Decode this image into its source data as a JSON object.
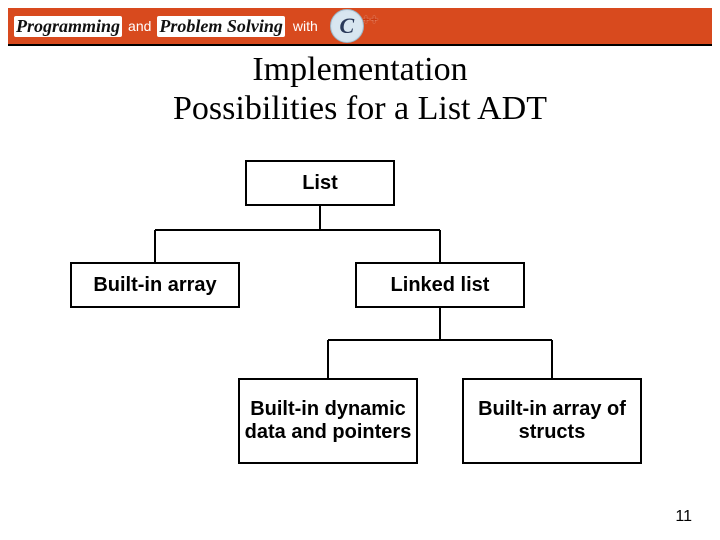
{
  "header": {
    "programming": "Programming",
    "and": "and",
    "problem_solving": "Problem Solving",
    "with": "with",
    "c_letter": "C",
    "plus": "++"
  },
  "title_line1": "Implementation",
  "title_line2": "Possibilities for a List ADT",
  "nodes": {
    "list": "List",
    "builtin_array": "Built-in array",
    "linked_list": "Linked list",
    "dynamic": "Built-in dynamic data and pointers",
    "array_of_structs": "Built-in array of structs"
  },
  "page_number": "11"
}
